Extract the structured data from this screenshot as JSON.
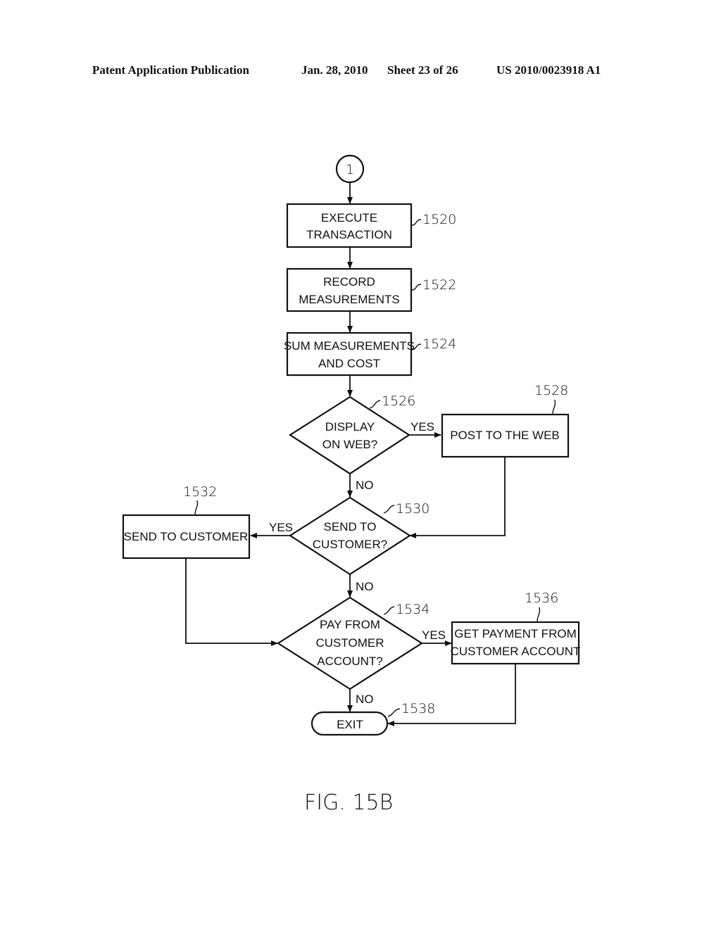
{
  "header": {
    "publication": "Patent Application Publication",
    "date": "Jan. 28, 2010",
    "sheet": "Sheet 23 of 26",
    "number": "US 2010/0023918 A1"
  },
  "connector": {
    "label": "1"
  },
  "nodes": {
    "n1520": {
      "type": "process",
      "lines": [
        "EXECUTE",
        "TRANSACTION"
      ],
      "ref": "1520"
    },
    "n1522": {
      "type": "process",
      "lines": [
        "RECORD",
        "MEASUREMENTS"
      ],
      "ref": "1522"
    },
    "n1524": {
      "type": "process",
      "lines": [
        "SUM MEASUREMENTS",
        "AND COST"
      ],
      "ref": "1524"
    },
    "n1526": {
      "type": "decision",
      "lines": [
        "DISPLAY",
        "ON WEB?"
      ],
      "ref": "1526"
    },
    "n1528": {
      "type": "process",
      "lines": [
        "POST TO THE WEB"
      ],
      "ref": "1528"
    },
    "n1530": {
      "type": "decision",
      "lines": [
        "SEND TO",
        "CUSTOMER?"
      ],
      "ref": "1530"
    },
    "n1532": {
      "type": "process",
      "lines": [
        "SEND TO CUSTOMER"
      ],
      "ref": "1532"
    },
    "n1534": {
      "type": "decision",
      "lines": [
        "PAY FROM",
        "CUSTOMER",
        "ACCOUNT?"
      ],
      "ref": "1534"
    },
    "n1536": {
      "type": "process",
      "lines": [
        "GET PAYMENT FROM",
        "CUSTOMER ACCOUNT"
      ],
      "ref": "1536"
    },
    "n1538": {
      "type": "terminal",
      "lines": [
        "EXIT"
      ],
      "ref": "1538"
    }
  },
  "edges": {
    "e1526_yes": "YES",
    "e1526_no": "NO",
    "e1530_yes": "YES",
    "e1530_no": "NO",
    "e1534_yes": "YES",
    "e1534_no": "NO"
  },
  "figure": {
    "caption": "FIG. 15B"
  }
}
